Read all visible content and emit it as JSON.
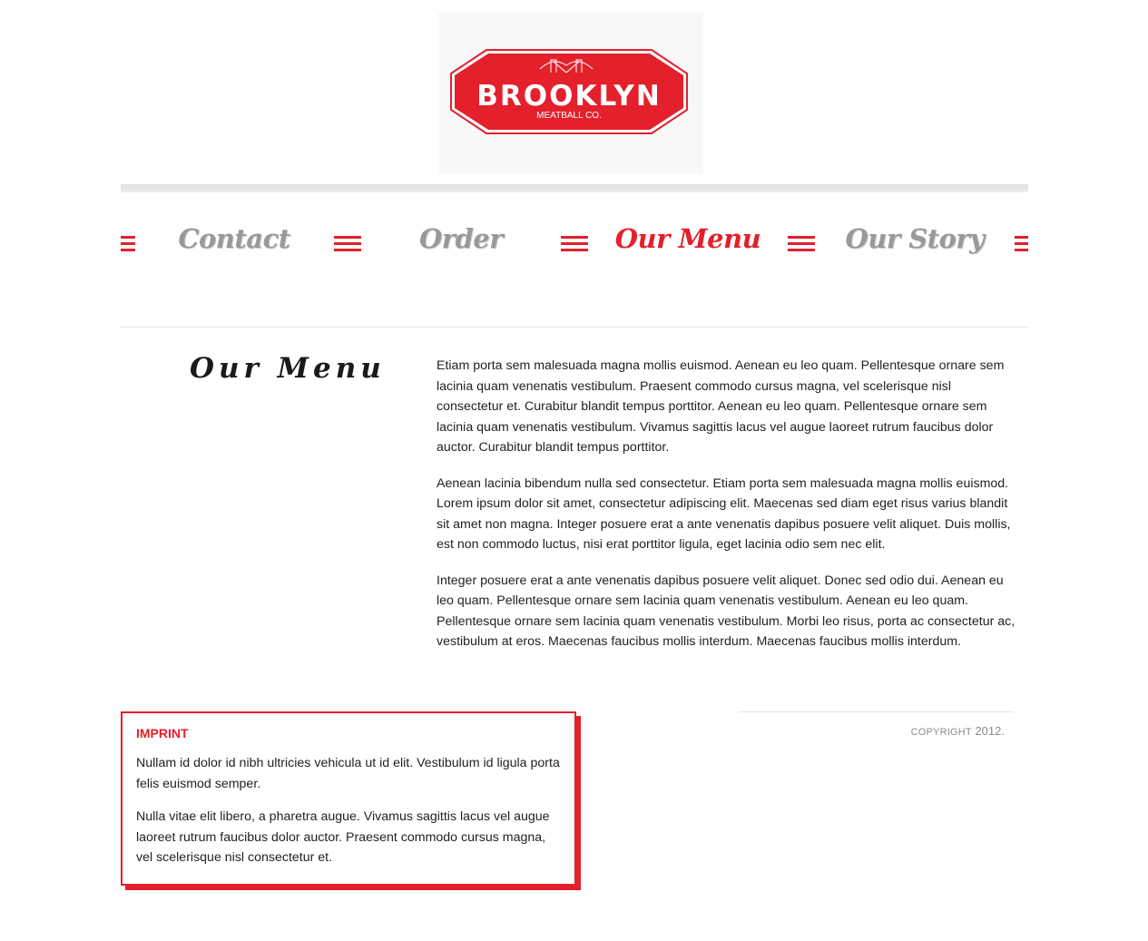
{
  "logo": {
    "name": "BROOKLYN",
    "tagline": "MEATBALL CO.",
    "color": "#e3202b"
  },
  "nav": {
    "items": [
      {
        "label": "Contact",
        "active": false
      },
      {
        "label": "Order",
        "active": false
      },
      {
        "label": "Our Menu",
        "active": true
      },
      {
        "label": "Our Story",
        "active": false
      }
    ],
    "separator_icon": "hamburger-lines-icon"
  },
  "main": {
    "heading": "Our Menu",
    "paragraphs": [
      "Etiam porta sem malesuada magna mollis euismod. Aenean eu leo quam. Pellentesque ornare sem lacinia quam venenatis vestibulum. Praesent commodo cursus magna, vel scelerisque nisl consectetur et. Curabitur blandit tempus porttitor. Aenean eu leo quam. Pellentesque ornare sem lacinia quam venenatis vestibulum. Vivamus sagittis lacus vel augue laoreet rutrum faucibus dolor auctor. Curabitur blandit tempus porttitor.",
      "Aenean lacinia bibendum nulla sed consectetur. Etiam porta sem malesuada magna mollis euismod. Lorem ipsum dolor sit amet, consectetur adipiscing elit. Maecenas sed diam eget risus varius blandit sit amet non magna. Integer posuere erat a ante venenatis dapibus posuere velit aliquet. Duis mollis, est non commodo luctus, nisi erat porttitor ligula, eget lacinia odio sem nec elit.",
      "Integer posuere erat a ante venenatis dapibus posuere velit aliquet. Donec sed odio dui. Aenean eu leo quam. Pellentesque ornare sem lacinia quam venenatis vestibulum. Aenean eu leo quam. Pellentesque ornare sem lacinia quam venenatis vestibulum. Morbi leo risus, porta ac consectetur ac, vestibulum at eros. Maecenas faucibus mollis interdum. Maecenas faucibus mollis interdum."
    ]
  },
  "imprint": {
    "title": "IMPRINT",
    "paragraphs": [
      "Nullam id dolor id nibh ultricies vehicula ut id elit. Vestibulum id ligula porta felis euismod semper.",
      "Nulla vitae elit libero, a pharetra augue. Vivamus sagittis lacus vel augue laoreet rutrum faucibus dolor auctor. Praesent commodo cursus magna, vel scelerisque nisl consectetur et."
    ]
  },
  "footer": {
    "copyright_label": "COPYRIGHT",
    "copyright_year": "2012."
  },
  "colors": {
    "accent": "#e3202b",
    "nav_inactive": "#999999",
    "text": "#222222"
  }
}
